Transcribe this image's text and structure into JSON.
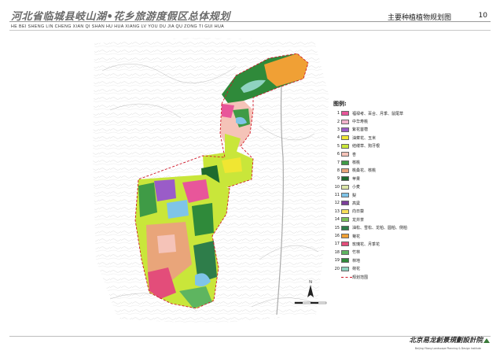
{
  "header": {
    "title": "河北省临城县岐山湖•花乡旅游度假区总体规划",
    "subtitle": "HE BEI SHENG LIN CHENG XIAN QI SHAN HU   HUA XIANG LV YOU DU JIA QU ZONG TI GUI HUA",
    "plan_name": "主要种植植物规划图",
    "page_number": "10"
  },
  "legend": {
    "title": "图例:",
    "items": [
      {
        "num": "1",
        "label": "福禄考、百合、月季、鼠尾草",
        "color": "#e8569a"
      },
      {
        "num": "2",
        "label": "中华寿桃",
        "color": "#f2b3cc"
      },
      {
        "num": "3",
        "label": "紫花苜蓿",
        "color": "#9a5cc8"
      },
      {
        "num": "4",
        "label": "油菜花、玉米",
        "color": "#f0e632"
      },
      {
        "num": "5",
        "label": "结缕草、狗牙根",
        "color": "#c9e63a"
      },
      {
        "num": "6",
        "label": "杏",
        "color": "#f5c3b8"
      },
      {
        "num": "7",
        "label": "核桃",
        "color": "#3f9b46"
      },
      {
        "num": "8",
        "label": "桃桑花、核桃",
        "color": "#e9a57a"
      },
      {
        "num": "9",
        "label": "苹果",
        "color": "#1e6b2e"
      },
      {
        "num": "10",
        "label": "小麦",
        "color": "#dde7a8"
      },
      {
        "num": "11",
        "label": "梨",
        "color": "#7fc4e8"
      },
      {
        "num": "12",
        "label": "高粱",
        "color": "#7b3e9a"
      },
      {
        "num": "13",
        "label": "向日葵",
        "color": "#f7df5a"
      },
      {
        "num": "14",
        "label": "龙井茶",
        "color": "#7bc25a"
      },
      {
        "num": "15",
        "label": "油松、雪松、龙柏、圆柏、侧柏",
        "color": "#2e7d4a"
      },
      {
        "num": "16",
        "label": "菊花",
        "color": "#f0a035"
      },
      {
        "num": "17",
        "label": "玫瑰花、月季花",
        "color": "#e34d7a"
      },
      {
        "num": "18",
        "label": "竹林",
        "color": "#5eb560"
      },
      {
        "num": "19",
        "label": "林地",
        "color": "#2f8a3a"
      },
      {
        "num": "20",
        "label": "荷花",
        "color": "#8fd3c0"
      }
    ],
    "range_label": "规划范围",
    "range_color": "#d0192a"
  },
  "compass": {
    "label": "N"
  },
  "footer": {
    "logo": "北京易龙創景規劃設計院",
    "sub": "Beijing Yilong Landscape Planning & Design Institute"
  }
}
